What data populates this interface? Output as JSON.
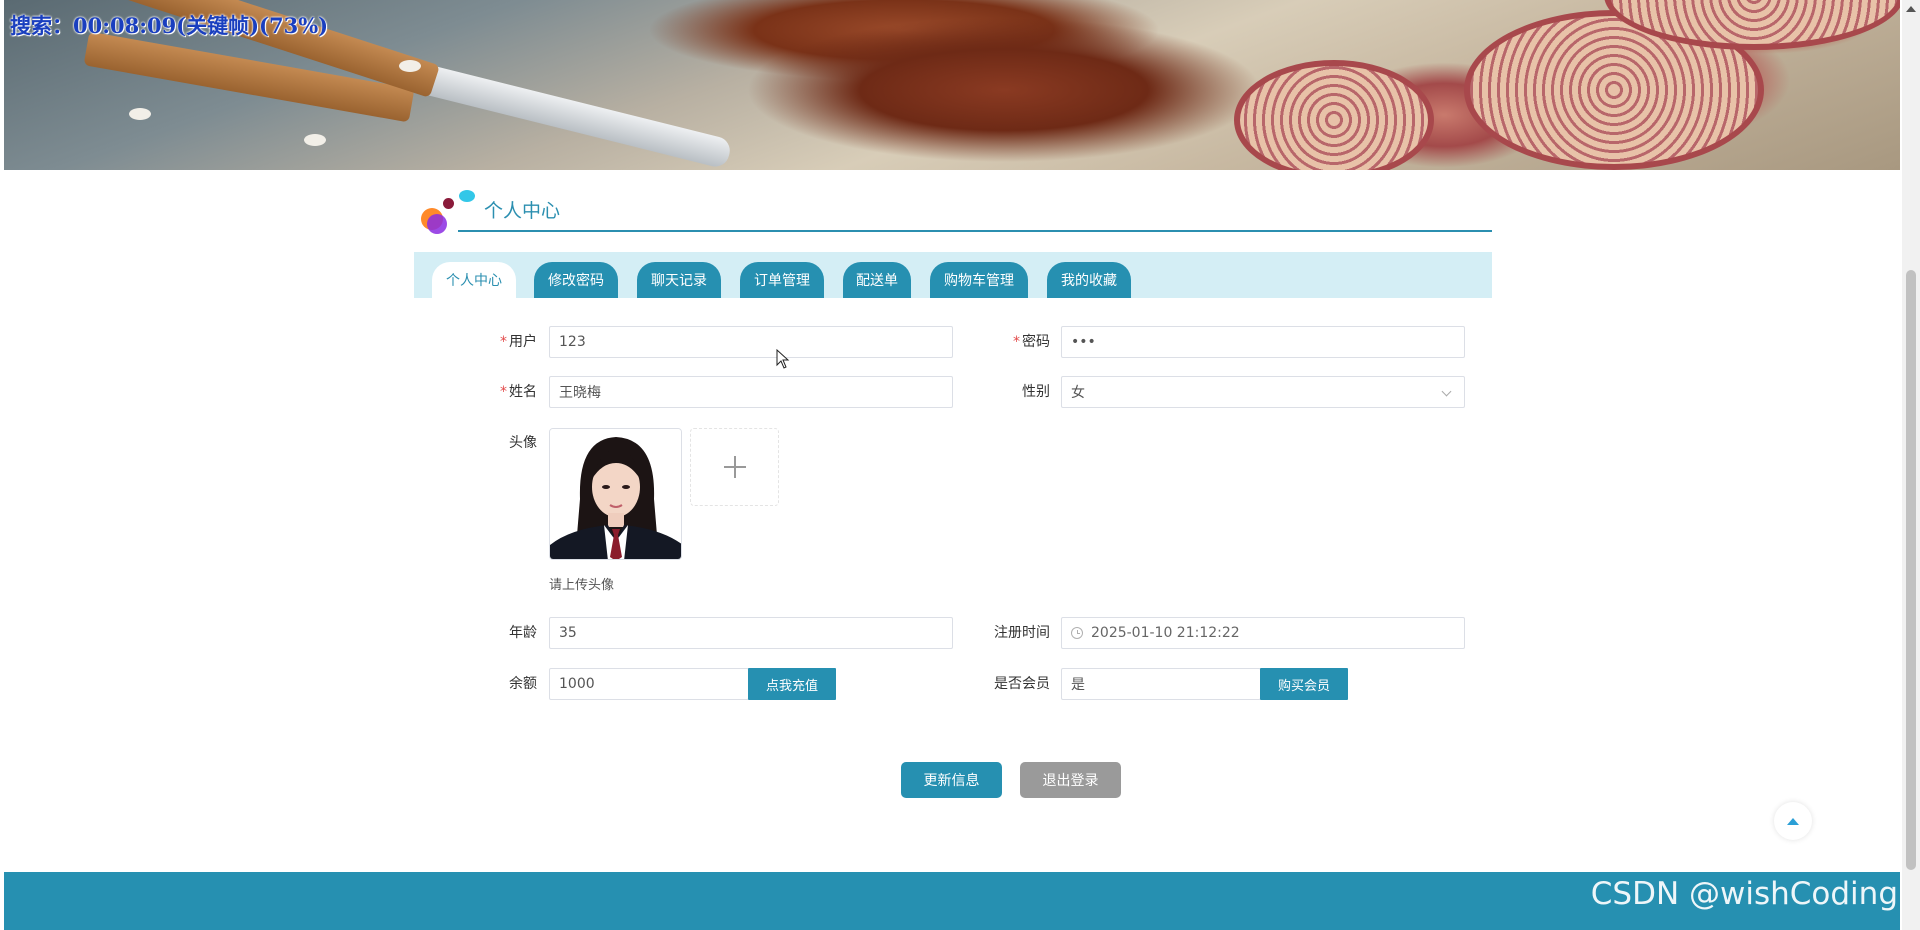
{
  "overlay": {
    "search_status": "搜索：00:08:09(关键帧)(73%)"
  },
  "section": {
    "title": "个人中心"
  },
  "tabs": [
    {
      "label": "个人中心",
      "active": true
    },
    {
      "label": "修改密码",
      "active": false
    },
    {
      "label": "聊天记录",
      "active": false
    },
    {
      "label": "订单管理",
      "active": false
    },
    {
      "label": "配送单",
      "active": false
    },
    {
      "label": "购物车管理",
      "active": false
    },
    {
      "label": "我的收藏",
      "active": false
    }
  ],
  "form": {
    "username": {
      "label": "用户",
      "value": "123",
      "required": true
    },
    "password": {
      "label": "密码",
      "value": "•••",
      "required": true
    },
    "name": {
      "label": "姓名",
      "value": "王晓梅",
      "required": true
    },
    "gender": {
      "label": "性别",
      "value": "女"
    },
    "avatar": {
      "label": "头像",
      "hint": "请上传头像"
    },
    "age": {
      "label": "年龄",
      "value": "35"
    },
    "register_time": {
      "label": "注册时间",
      "value": "2025-01-10 21:12:22"
    },
    "balance": {
      "label": "余额",
      "value": "1000",
      "action": "点我充值"
    },
    "is_member": {
      "label": "是否会员",
      "value": "是",
      "action": "购买会员"
    }
  },
  "actions": {
    "update": "更新信息",
    "logout": "退出登录"
  },
  "watermark": "CSDN @wishCoding",
  "colors": {
    "primary": "#2690b1",
    "tabbar_bg": "#d4eef5",
    "required": "#e24a4a",
    "logout_bg": "#9a9a9a"
  }
}
